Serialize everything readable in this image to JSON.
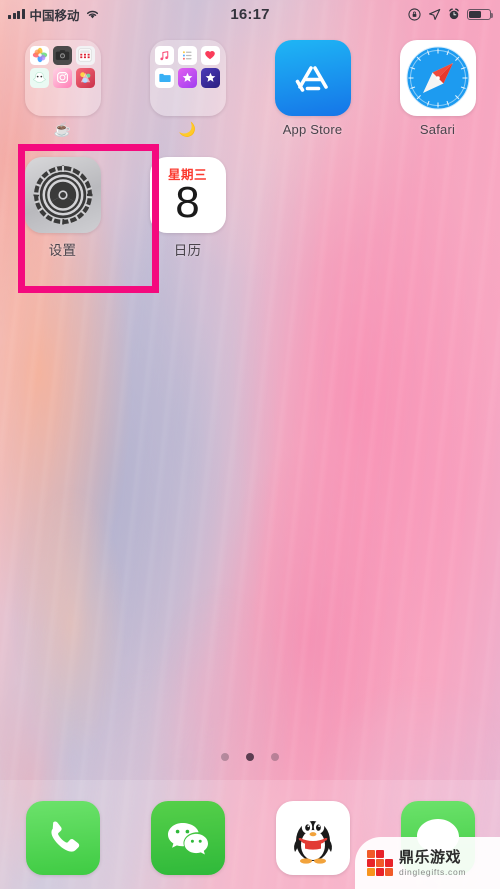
{
  "status_bar": {
    "carrier": "中国移动",
    "signal_icon": "signal-bars-icon",
    "wifi_icon": "wifi-icon",
    "time": "16:17",
    "rotation_lock_icon": "rotation-lock-icon",
    "location_icon": "location-arrow-icon",
    "alarm_icon": "alarm-clock-icon",
    "battery_icon": "battery-icon",
    "battery_level_percent": 62
  },
  "home_screen": {
    "apps": [
      {
        "name": "folder-1",
        "type": "folder",
        "label": "☕",
        "mini_icons": [
          "photos-icon",
          "camera-icon",
          "calculator-icon",
          "snapchat-icon",
          "instagram-icon",
          "art-app-icon"
        ]
      },
      {
        "name": "folder-2",
        "type": "folder",
        "label": "🌙",
        "mini_icons": [
          "music-icon",
          "reminders-icon",
          "health-icon",
          "files-icon",
          "photos-star-icon",
          "imovie-icon"
        ]
      },
      {
        "name": "app-store",
        "type": "app",
        "label": "App Store",
        "icon": "app-store-icon"
      },
      {
        "name": "safari",
        "type": "app",
        "label": "Safari",
        "icon": "safari-compass-icon"
      },
      {
        "name": "settings",
        "type": "app",
        "label": "设置",
        "icon": "settings-gear-icon",
        "highlighted": true
      },
      {
        "name": "calendar",
        "type": "app",
        "label": "日历",
        "icon": "calendar-icon",
        "weekday": "星期三",
        "day": "8"
      }
    ],
    "page_dots": {
      "total": 3,
      "active_index": 1
    }
  },
  "dock": {
    "items": [
      {
        "name": "phone",
        "label": "",
        "icon": "phone-handset-icon"
      },
      {
        "name": "wechat",
        "label": "",
        "icon": "wechat-bubbles-icon"
      },
      {
        "name": "qq",
        "label": "",
        "icon": "qq-penguin-icon"
      },
      {
        "name": "messages",
        "label": "",
        "icon": "messages-bubble-icon"
      }
    ]
  },
  "watermark": {
    "logo_icon": "dingle-checker-logo",
    "brand_cn": "鼎乐游戏",
    "url": "dinglegifts.com"
  },
  "colors": {
    "highlight_box": "#f40a7e",
    "calendar_red": "#fb3b30",
    "app_store_blue": "#1575e8",
    "dock_green": "#3fcb43"
  }
}
